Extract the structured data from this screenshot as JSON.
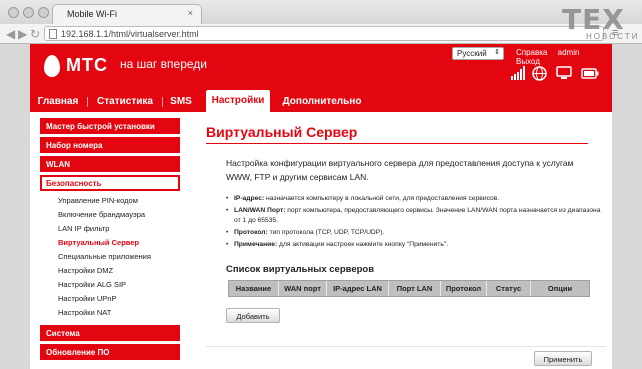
{
  "browser": {
    "tab_title": "Mobile Wi-Fi",
    "tab_close": "×",
    "url": "192.168.1.1/html/virtualserver.html"
  },
  "watermark": {
    "main": "TEX",
    "sub": "НОВОСТИ"
  },
  "header": {
    "logo": "МТС",
    "slogan": "на шаг впереди",
    "language": "Русский",
    "links": {
      "help": "Справка",
      "user": "admin",
      "logout": "Выход"
    },
    "icons": [
      "signal-bars-icon",
      "globe-icon",
      "monitor-icon",
      "battery-icon"
    ]
  },
  "menu": {
    "tabs": [
      {
        "label": "Главная"
      },
      {
        "label": "Статистика"
      },
      {
        "label": "SMS"
      },
      {
        "label": "Настройки"
      },
      {
        "label": "Дополнительно"
      }
    ],
    "active": "Настройки"
  },
  "sidebar": {
    "groups": [
      {
        "label": "Мастер быстрой установки"
      },
      {
        "label": "Набор номера"
      },
      {
        "label": "WLAN"
      },
      {
        "label": "Безопасность"
      },
      {
        "label": "Система"
      },
      {
        "label": "Обновление ПО"
      }
    ],
    "security_items": [
      "Управление PIN-кодом",
      "Включение брандмауэра",
      "LAN IP фильтр",
      "Виртуальный Сервер",
      "Специальные приложения",
      "Настройки DMZ",
      "Настройки ALG SIP",
      "Настройки UPnP",
      "Настройки NAT"
    ],
    "selected_item": "Виртуальный Сервер"
  },
  "main": {
    "title": "Виртуальный Сервер",
    "description": "Настройка конфигурации виртуального сервера для предоставления доступа к услугам WWW, FTP  и другим сервисам LAN.",
    "bullets": [
      {
        "term": "IP-адрес:",
        "text": " назначается компьютеру в локальной сети, для предоставления сервисов."
      },
      {
        "term": "LAN/WAN Порт:",
        "text": " порт компьютера, предоставляющего сервисы. Значение LAN/WAN порта назначается из диапазона от 1 до 65535."
      },
      {
        "term": "Протокол:",
        "text": " тип протокола (TCP, UDP, TCP/UDP)."
      },
      {
        "term": "Примечание:",
        "text": " для активации настроек нажмите кнопку \"Применить\"."
      }
    ],
    "list_title": "Список виртуальных серверов",
    "table_headers": [
      "Название",
      "WAN порт",
      "IP-адрес LAN",
      "Порт LAN",
      "Протокол",
      "Статус",
      "Опции"
    ],
    "add_button": "Добавить",
    "apply_button": "Применить"
  },
  "colors": {
    "accent": "#e30611",
    "table_header": "#bfbfbf"
  }
}
